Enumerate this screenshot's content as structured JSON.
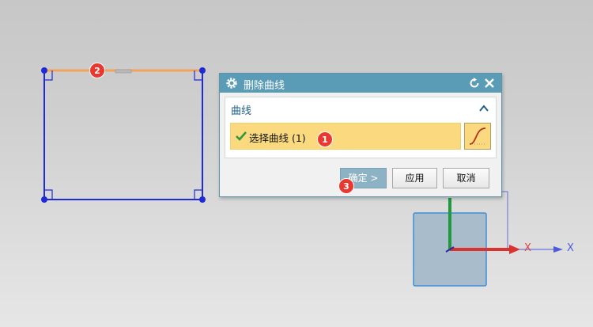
{
  "dialog": {
    "title": "删除曲线",
    "group_label": "曲线",
    "select_label": "选择曲线 (1)",
    "buttons": {
      "ok": "确定 >",
      "apply": "应用",
      "cancel": "取消"
    }
  },
  "badges": [
    "1",
    "2",
    "3"
  ],
  "axes": {
    "x_red": "X",
    "x_blue": "X"
  },
  "icons": {
    "gear": "gear-icon",
    "reset": "reset-icon",
    "close": "close-icon",
    "collapse": "chevron-up-icon",
    "check": "check-icon",
    "curve": "curve-icon"
  },
  "colors": {
    "titlebar": "#5a9cb6",
    "selection_row": "#fbd97f",
    "rectangle": "#1f2bd6",
    "highlight_edge": "#f4a25a",
    "badge": "#e9382f"
  }
}
